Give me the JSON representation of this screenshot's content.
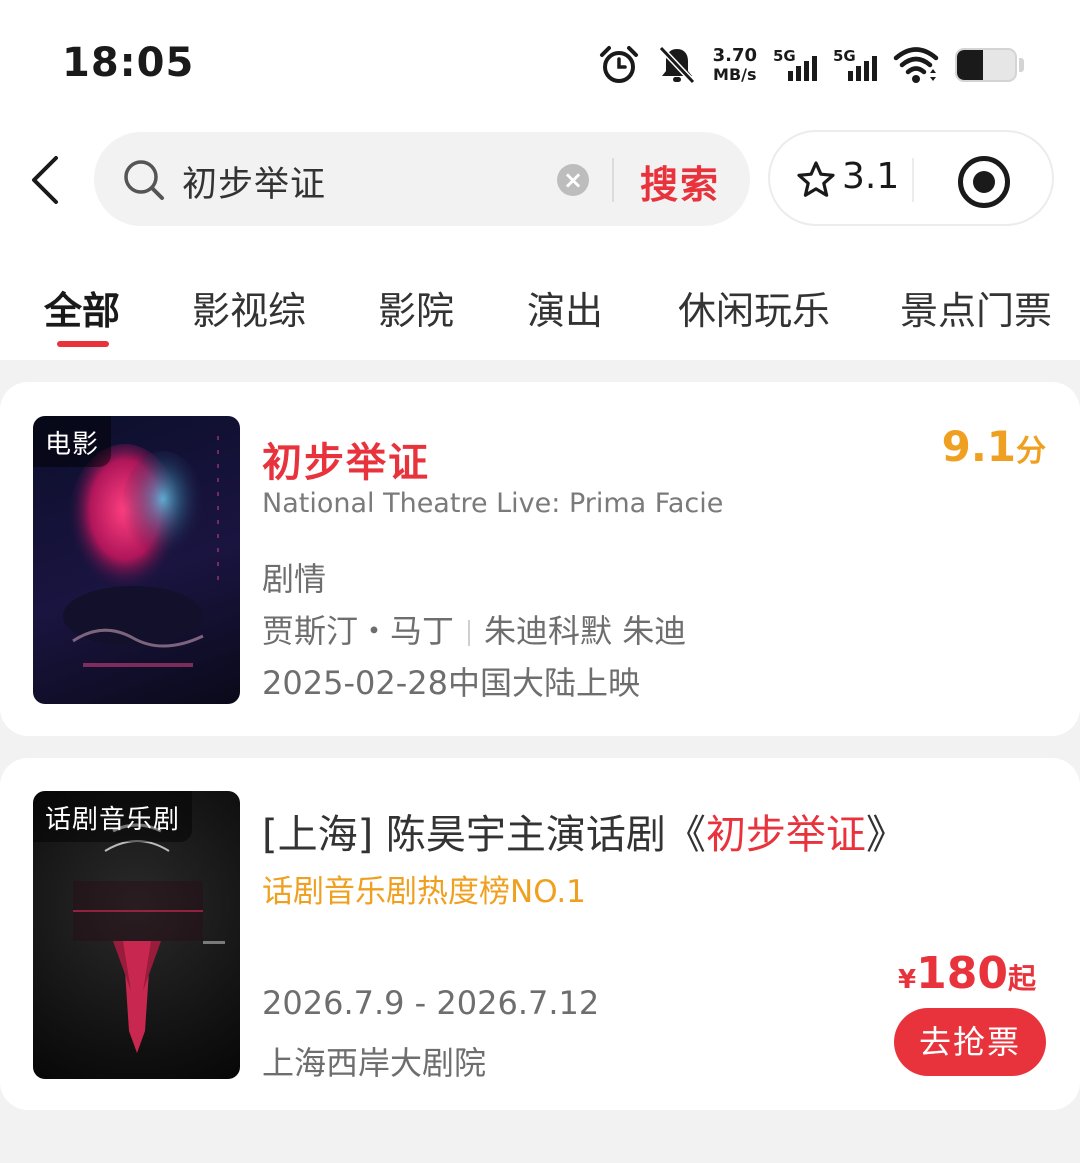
{
  "status_bar": {
    "time": "18:05",
    "net_speed_value": "3.70",
    "net_speed_unit": "MB/s",
    "sim1_label": "5G",
    "sim2_label": "5G",
    "battery_level": 0.45
  },
  "search": {
    "query": "初步举证",
    "button_label": "搜索"
  },
  "capsule": {
    "rating": "3.1"
  },
  "tabs": [
    {
      "label": "全部",
      "active": true
    },
    {
      "label": "影视综"
    },
    {
      "label": "影院"
    },
    {
      "label": "演出"
    },
    {
      "label": "休闲玩乐"
    },
    {
      "label": "景点门票"
    }
  ],
  "results": [
    {
      "tag": "电影",
      "title": "初步举证",
      "subtitle": "National Theatre Live: Prima Facie",
      "score": "9.1",
      "score_unit": "分",
      "genre": "剧情",
      "director": "贾斯汀・马丁",
      "cast": "朱迪科默 朱迪",
      "release": "2025-02-28中国大陆上映"
    },
    {
      "tag": "话剧音乐剧",
      "title_prefix": "[上海] 陈昊宇主演话剧《",
      "title_highlight": "初步举证",
      "title_suffix": "》",
      "rank": "话剧音乐剧热度榜NO.1",
      "dates": "2026.7.9 - 2026.7.12",
      "venue": "上海西岸大剧院",
      "price_currency": "¥",
      "price": "180",
      "price_suffix": "起",
      "button_label": "去抢票"
    }
  ]
}
